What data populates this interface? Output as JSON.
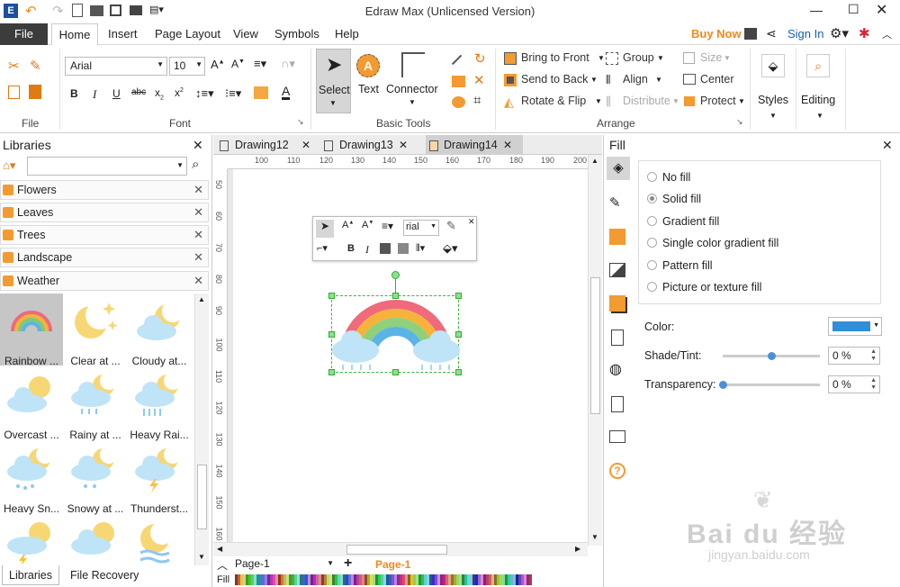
{
  "window": {
    "title": "Edraw Max (Unlicensed Version)"
  },
  "menu": {
    "file": "File",
    "tabs": [
      "Home",
      "Insert",
      "Page Layout",
      "View",
      "Symbols",
      "Help"
    ],
    "buy_now": "Buy Now",
    "sign_in": "Sign In"
  },
  "ribbon": {
    "font_name": "Arial",
    "font_size": "10",
    "groups": {
      "file": "File",
      "font": "Font",
      "basic_tools": "Basic Tools",
      "arrange": "Arrange"
    },
    "tools": {
      "select": "Select",
      "text": "Text",
      "connector": "Connector"
    },
    "arrange": {
      "bring_to_front": "Bring to Front",
      "send_to_back": "Send to Back",
      "rotate_flip": "Rotate & Flip",
      "group": "Group",
      "align": "Align",
      "distribute": "Distribute",
      "size": "Size",
      "center": "Center",
      "protect": "Protect"
    },
    "styles": "Styles",
    "editing": "Editing"
  },
  "libraries": {
    "title": "Libraries",
    "categories": [
      "Flowers",
      "Leaves",
      "Trees",
      "Landscape",
      "Weather"
    ],
    "shapes": [
      "Rainbow ...",
      "Clear at ...",
      "Cloudy at...",
      "Overcast ...",
      "Rainy at ...",
      "Heavy Rai...",
      "Heavy Sn...",
      "Snowy at ...",
      "Thunderst...",
      "",
      "",
      ""
    ],
    "bottom_tabs": [
      "Libraries",
      "File Recovery"
    ]
  },
  "docs": {
    "tabs": [
      "Drawing12",
      "Drawing13",
      "Drawing14"
    ]
  },
  "ruler": {
    "top": [
      "100",
      "110",
      "120",
      "130",
      "140",
      "150",
      "160",
      "170",
      "180",
      "190",
      "200"
    ],
    "left": [
      "50",
      "60",
      "70",
      "80",
      "90",
      "100",
      "110",
      "120",
      "130",
      "140",
      "150",
      "160"
    ]
  },
  "floattoolbar": {
    "font": "rial"
  },
  "pages": {
    "selector": "Page-1",
    "active": "Page-1"
  },
  "fillbar": {
    "label": "Fill"
  },
  "fill_panel": {
    "title": "Fill",
    "options": [
      "No fill",
      "Solid fill",
      "Gradient fill",
      "Single color gradient fill",
      "Pattern fill",
      "Picture or texture fill"
    ],
    "selected": "Solid fill",
    "color_label": "Color:",
    "color": "#2f8fd8",
    "shade_label": "Shade/Tint:",
    "shade_value": "0 %",
    "shade_level": 0.5,
    "transparency_label": "Transparency:",
    "transparency_value": "0 %",
    "transparency_level": 0
  },
  "watermark": {
    "main": "Bai du 经验",
    "sub": "jingyan.baidu.com"
  }
}
